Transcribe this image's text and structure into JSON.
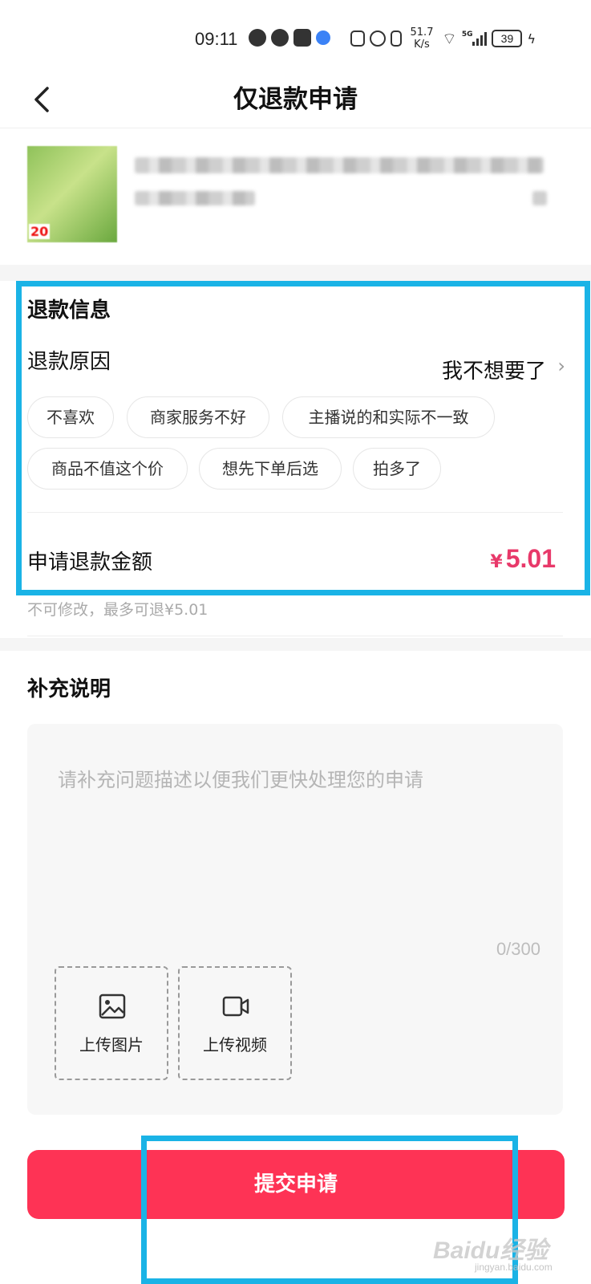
{
  "status_bar": {
    "time": "09:11",
    "net_speed_value": "51.7",
    "net_speed_unit": "K/s",
    "network": "5G",
    "battery": "39"
  },
  "header": {
    "title": "仅退款申请",
    "back_icon": "chevron-left-icon"
  },
  "refund_info": {
    "section_title": "退款信息",
    "reason_label": "退款原因",
    "reason_value": "我不想要了",
    "reason_chevron": "›",
    "reason_chips": [
      {
        "label": "不喜欢"
      },
      {
        "label": "商家服务不好"
      },
      {
        "label": "主播说的和实际不一致"
      },
      {
        "label": "商品不值这个价"
      },
      {
        "label": "想先下单后选"
      },
      {
        "label": "拍多了"
      }
    ],
    "amount_label": "申请退款金额",
    "amount_currency": "¥",
    "amount_value": "5.01",
    "amount_color": "#e8396a",
    "amount_hint": "不可修改，最多可退¥5.01"
  },
  "note": {
    "section_title": "补充说明",
    "placeholder": "请补充问题描述以便我们更快处理您的申请",
    "counter": "0/300",
    "upload_image_label": "上传图片",
    "upload_video_label": "上传视频"
  },
  "footer": {
    "submit_label": "提交申请",
    "submit_color": "#fe3355",
    "highlight_color": "#1ab3e6"
  },
  "watermark": {
    "brand": "Baidu经验",
    "url": "jingyan.baidu.com"
  }
}
